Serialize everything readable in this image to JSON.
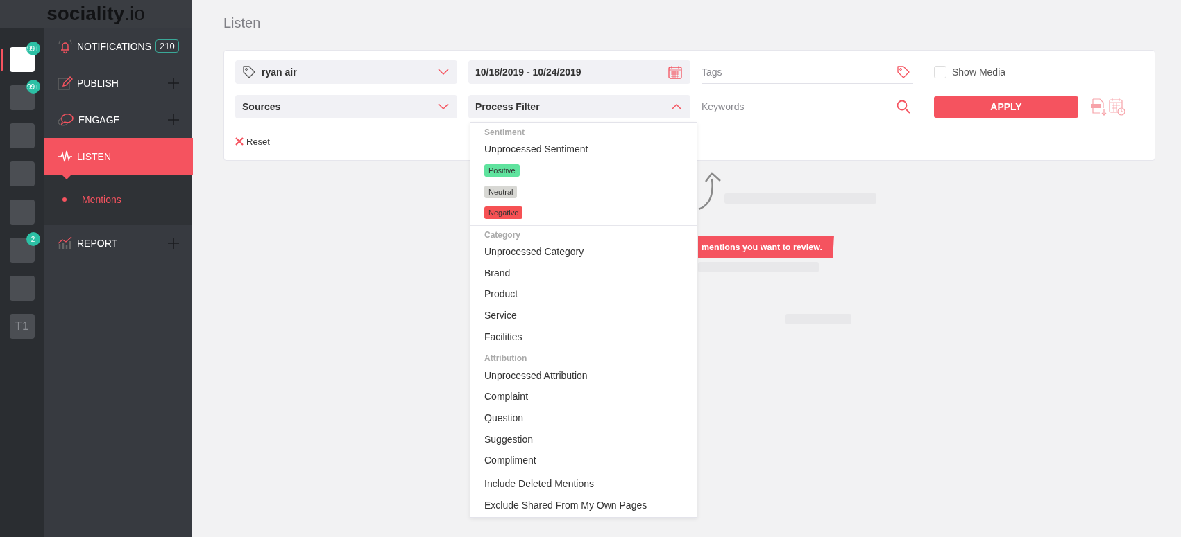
{
  "brand": {
    "name": "sociality",
    "suffix": ".io"
  },
  "accounts": [
    {
      "kind": "logo",
      "badge": "99+",
      "selected": true
    },
    {
      "kind": "logo",
      "badge": "99+",
      "selected": false
    },
    {
      "kind": "logo",
      "selected": false
    },
    {
      "kind": "logo",
      "selected": false
    },
    {
      "kind": "logo",
      "selected": false
    },
    {
      "kind": "logo",
      "badge": "2",
      "selected": false
    },
    {
      "kind": "logo",
      "selected": false
    },
    {
      "kind": "initials",
      "initials": "T1",
      "selected": false
    }
  ],
  "nav": [
    {
      "kind": "bell",
      "label": "NOTIFICATIONS",
      "count": "210",
      "expandable": false,
      "selected": false
    },
    {
      "kind": "pencil",
      "label": "PUBLISH",
      "expandable": true,
      "selected": false
    },
    {
      "kind": "bubble",
      "label": "ENGAGE",
      "expandable": true,
      "selected": false
    },
    {
      "kind": "wave",
      "label": "LISTEN",
      "expandable": false,
      "selected": true,
      "children": [
        {
          "label": "Mentions",
          "selected": true
        }
      ]
    },
    {
      "kind": "chart",
      "label": "REPORT",
      "expandable": true,
      "selected": false
    }
  ],
  "page_title": "Listen",
  "filters": {
    "brand_select": {
      "value": "ryan air"
    },
    "date_range": {
      "value": "10/18/2019 - 10/24/2019"
    },
    "tags": {
      "placeholder": "Tags"
    },
    "show_media": {
      "label": "Show Media",
      "checked": false
    },
    "sources": {
      "value": "Sources"
    },
    "process_filter": {
      "value": "Process Filter",
      "expanded": true
    },
    "keywords": {
      "placeholder": "Keywords"
    },
    "apply": {
      "label": "APPLY"
    },
    "reset": {
      "label": "Reset"
    }
  },
  "process_menu": [
    {
      "header": "Sentiment",
      "items": [
        {
          "kind": "option",
          "label": "Unprocessed Sentiment"
        },
        {
          "kind": "tag",
          "label": "Positive",
          "color": "#5fe39e"
        },
        {
          "kind": "tag",
          "label": "Neutral",
          "color": "#d8d8d4"
        },
        {
          "kind": "tag",
          "label": "Negative",
          "color": "#f65154"
        }
      ]
    },
    {
      "header": "Category",
      "items": [
        {
          "kind": "option",
          "label": "Unprocessed Category"
        },
        {
          "kind": "option",
          "label": "Brand"
        },
        {
          "kind": "option",
          "label": "Product"
        },
        {
          "kind": "option",
          "label": "Service"
        },
        {
          "kind": "option",
          "label": "Facilities"
        }
      ]
    },
    {
      "header": "Attribution",
      "items": [
        {
          "kind": "option",
          "label": "Unprocessed Attribution"
        },
        {
          "kind": "option",
          "label": "Complaint"
        },
        {
          "kind": "option",
          "label": "Question"
        },
        {
          "kind": "option",
          "label": "Suggestion"
        },
        {
          "kind": "option",
          "label": "Compliment"
        }
      ]
    },
    {
      "items": [
        {
          "kind": "option",
          "label": "Include Deleted Mentions"
        },
        {
          "kind": "option",
          "label": "Exclude Shared From My Own Pages"
        }
      ]
    }
  ],
  "empty_hint": {
    "banner": "mentions you want to review."
  }
}
